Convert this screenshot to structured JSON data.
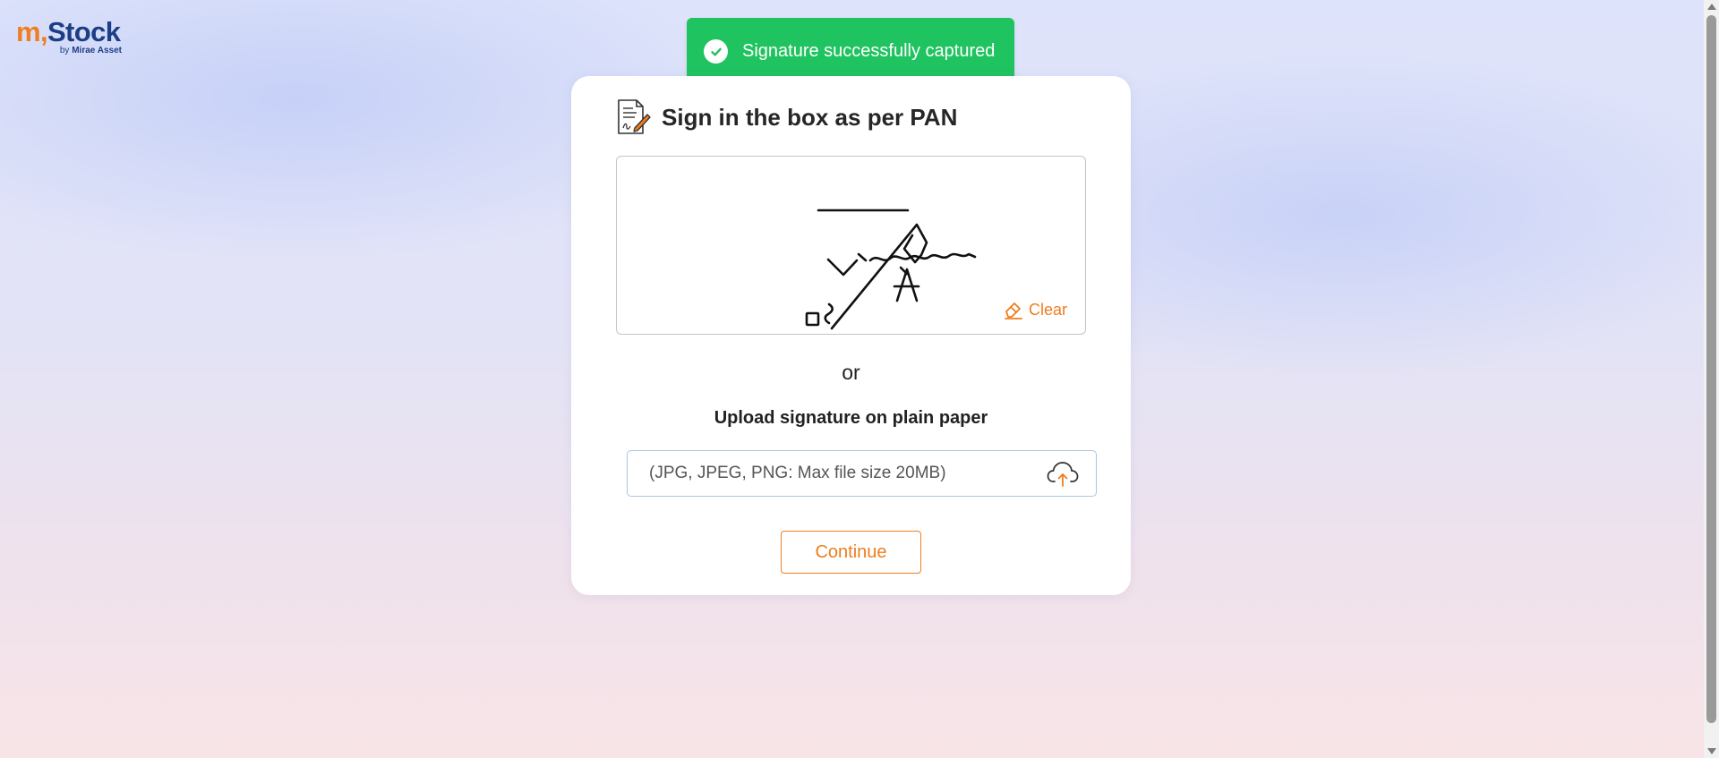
{
  "logo": {
    "brand_prefix": "m",
    "brand_name": "Stock",
    "by_text": "by",
    "company": "Mirae Asset"
  },
  "toast": {
    "message": "Signature successfully captured",
    "icon": "check-circle-icon",
    "color": "#1fc35f"
  },
  "card": {
    "title": "Sign in the box as per PAN",
    "title_icon": "document-pen-icon",
    "clear_label": "Clear",
    "or_text": "or",
    "upload_title": "Upload signature on plain paper",
    "upload_placeholder": "(JPG, JPEG, PNG: Max file size 20MB)",
    "upload_icon": "cloud-upload-icon",
    "continue_label": "Continue"
  },
  "colors": {
    "accent": "#f07d1e",
    "brand_blue": "#1c3e86",
    "success": "#1fc35f"
  }
}
